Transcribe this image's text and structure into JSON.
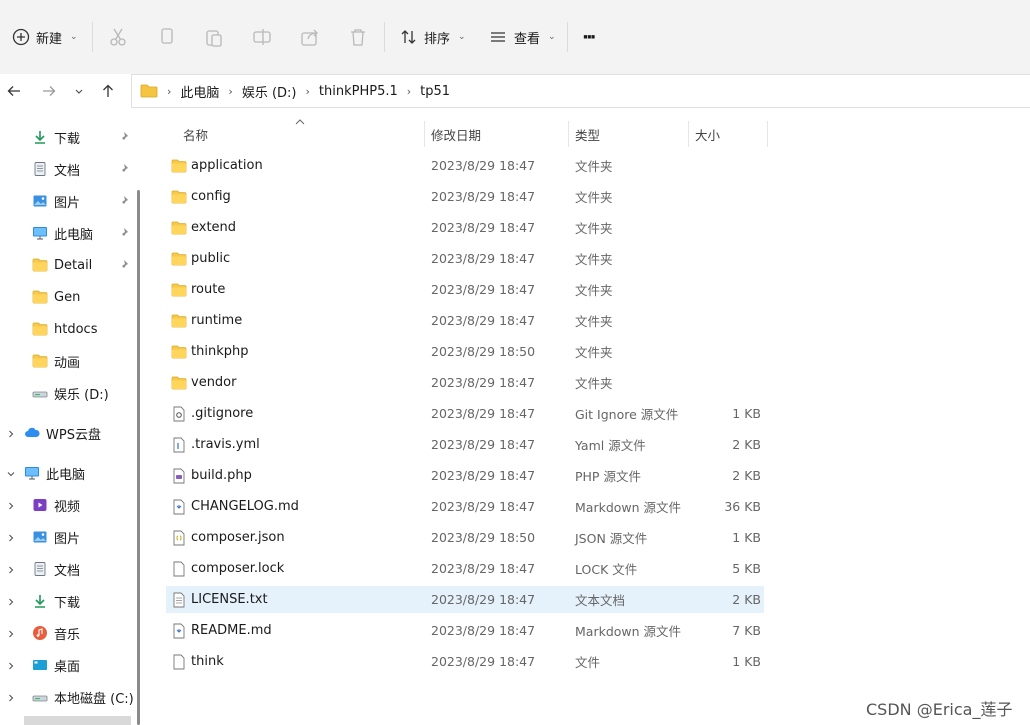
{
  "toolbar": {
    "new_label": "新建",
    "sort_label": "排序",
    "view_label": "查看",
    "more_label": "···"
  },
  "breadcrumb": [
    "此电脑",
    "娱乐 (D:)",
    "thinkPHP5.1",
    "tp51"
  ],
  "columns": {
    "name": "名称",
    "date": "修改日期",
    "type": "类型",
    "size": "大小"
  },
  "sidebar": {
    "quick": [
      {
        "label": "下载",
        "icon": "download-icon"
      },
      {
        "label": "文档",
        "icon": "document-icon"
      },
      {
        "label": "图片",
        "icon": "pictures-icon"
      },
      {
        "label": "此电脑",
        "icon": "computer-icon"
      },
      {
        "label": "Detail",
        "icon": "folder-icon"
      },
      {
        "label": "Gen",
        "icon": "folder-icon"
      },
      {
        "label": "htdocs",
        "icon": "folder-icon"
      },
      {
        "label": "动画",
        "icon": "folder-icon"
      },
      {
        "label": "娱乐 (D:)",
        "icon": "drive-icon"
      }
    ],
    "wps": "WPS云盘",
    "this_pc": "此电脑",
    "pc_children": [
      {
        "label": "视频",
        "icon": "video-icon"
      },
      {
        "label": "图片",
        "icon": "pictures-icon"
      },
      {
        "label": "文档",
        "icon": "document-icon"
      },
      {
        "label": "下载",
        "icon": "download-icon"
      },
      {
        "label": "音乐",
        "icon": "music-icon"
      },
      {
        "label": "桌面",
        "icon": "desktop-icon"
      },
      {
        "label": "本地磁盘 (C:)",
        "icon": "drive-icon"
      }
    ]
  },
  "files": [
    {
      "name": "application",
      "date": "2023/8/29 18:47",
      "type": "文件夹",
      "size": "",
      "icon": "folder"
    },
    {
      "name": "config",
      "date": "2023/8/29 18:47",
      "type": "文件夹",
      "size": "",
      "icon": "folder"
    },
    {
      "name": "extend",
      "date": "2023/8/29 18:47",
      "type": "文件夹",
      "size": "",
      "icon": "folder"
    },
    {
      "name": "public",
      "date": "2023/8/29 18:47",
      "type": "文件夹",
      "size": "",
      "icon": "folder"
    },
    {
      "name": "route",
      "date": "2023/8/29 18:47",
      "type": "文件夹",
      "size": "",
      "icon": "folder"
    },
    {
      "name": "runtime",
      "date": "2023/8/29 18:47",
      "type": "文件夹",
      "size": "",
      "icon": "folder"
    },
    {
      "name": "thinkphp",
      "date": "2023/8/29 18:50",
      "type": "文件夹",
      "size": "",
      "icon": "folder"
    },
    {
      "name": "vendor",
      "date": "2023/8/29 18:47",
      "type": "文件夹",
      "size": "",
      "icon": "folder"
    },
    {
      "name": ".gitignore",
      "date": "2023/8/29 18:47",
      "type": "Git Ignore 源文件",
      "size": "1 KB",
      "icon": "gear-file"
    },
    {
      "name": ".travis.yml",
      "date": "2023/8/29 18:47",
      "type": "Yaml 源文件",
      "size": "2 KB",
      "icon": "code-file"
    },
    {
      "name": "build.php",
      "date": "2023/8/29 18:47",
      "type": "PHP 源文件",
      "size": "2 KB",
      "icon": "php-file"
    },
    {
      "name": "CHANGELOG.md",
      "date": "2023/8/29 18:47",
      "type": "Markdown 源文件",
      "size": "36 KB",
      "icon": "md-file"
    },
    {
      "name": "composer.json",
      "date": "2023/8/29 18:50",
      "type": "JSON 源文件",
      "size": "1 KB",
      "icon": "json-file"
    },
    {
      "name": "composer.lock",
      "date": "2023/8/29 18:47",
      "type": "LOCK 文件",
      "size": "5 KB",
      "icon": "blank-file"
    },
    {
      "name": "LICENSE.txt",
      "date": "2023/8/29 18:47",
      "type": "文本文档",
      "size": "2 KB",
      "icon": "text-file",
      "selected": true
    },
    {
      "name": "README.md",
      "date": "2023/8/29 18:47",
      "type": "Markdown 源文件",
      "size": "7 KB",
      "icon": "md-file"
    },
    {
      "name": "think",
      "date": "2023/8/29 18:47",
      "type": "文件",
      "size": "1 KB",
      "icon": "blank-file"
    }
  ],
  "watermark": "CSDN @Erica_莲子"
}
